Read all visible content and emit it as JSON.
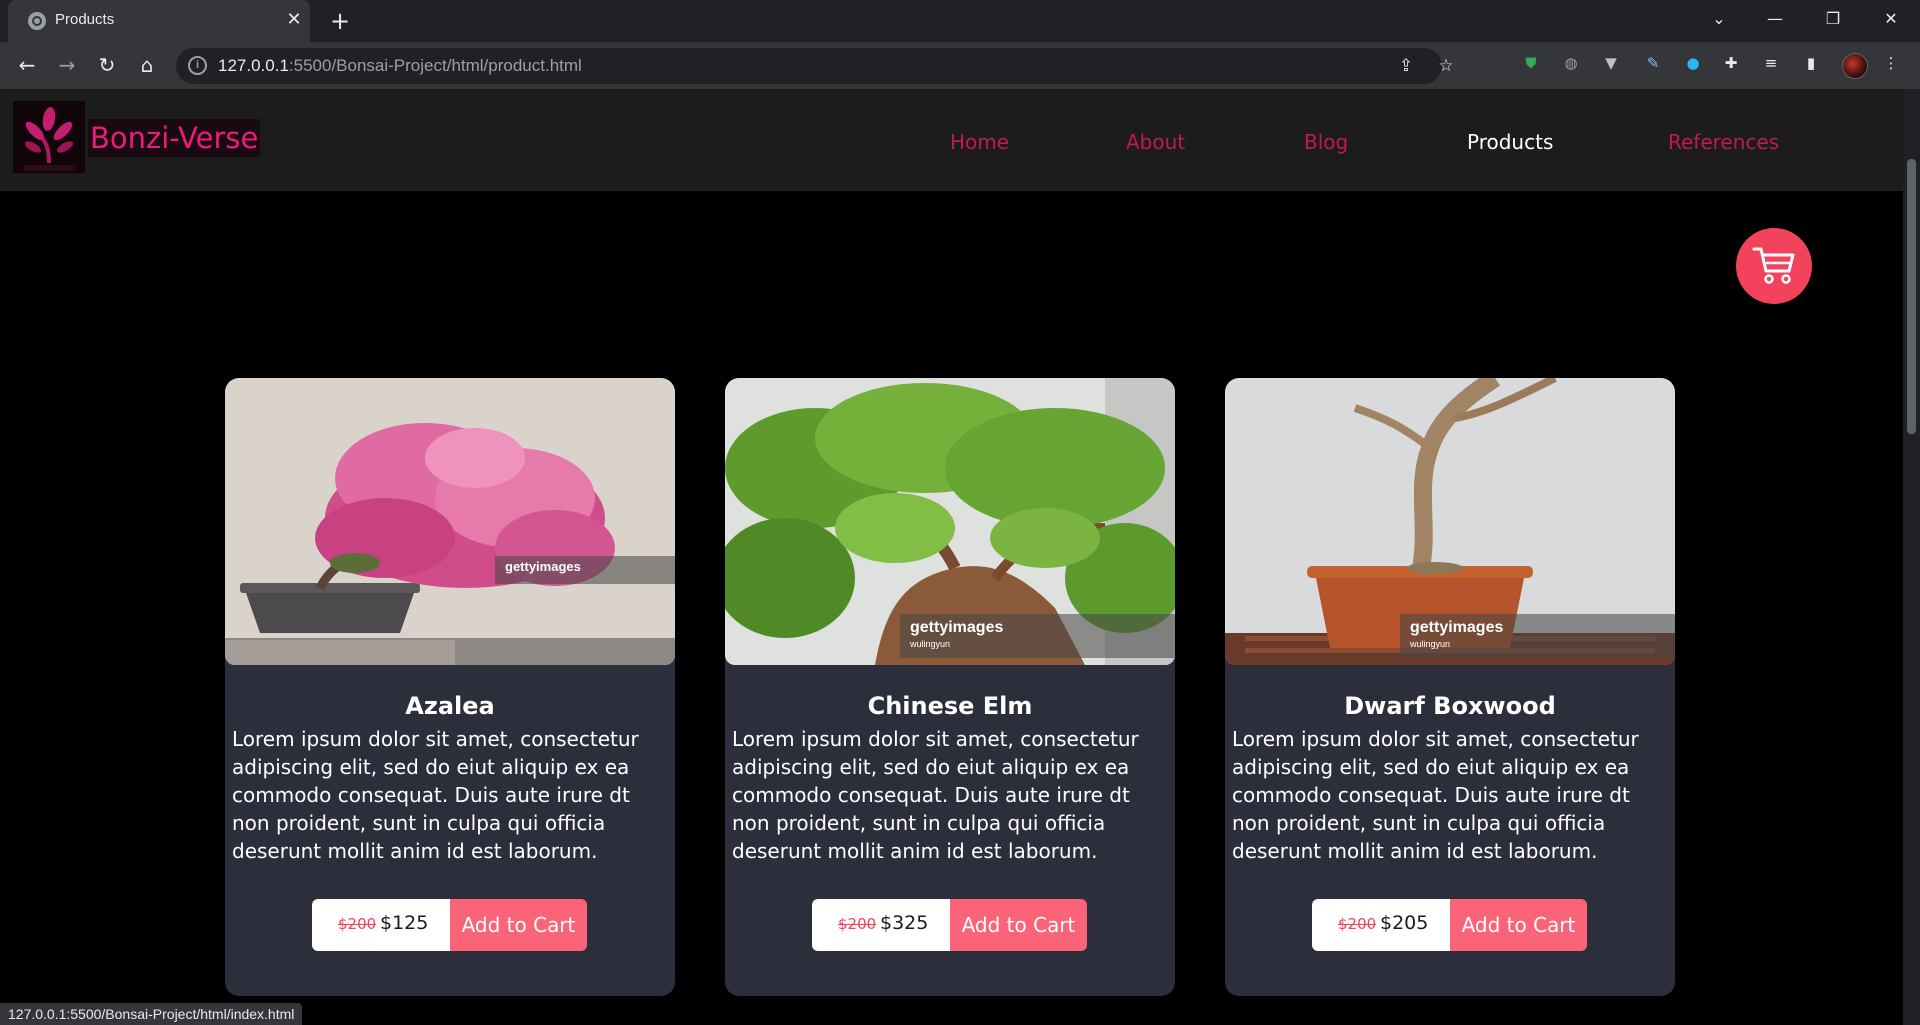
{
  "browser": {
    "tab_title": "Products",
    "url_host": "127.0.0.1",
    "url_path": ":5500/Bonsai-Project/html/product.html",
    "status_url": "127.0.0.1:5500/Bonsai-Project/html/index.html"
  },
  "site": {
    "brand": "Bonzi-Verse",
    "nav": [
      {
        "label": "Home",
        "active": false
      },
      {
        "label": "About",
        "active": false
      },
      {
        "label": "Blog",
        "active": false
      },
      {
        "label": "Products",
        "active": true
      },
      {
        "label": "References",
        "active": false
      }
    ],
    "cart_icon": "shopping-cart-icon"
  },
  "products": [
    {
      "name": "Azalea",
      "description": "Lorem ipsum dolor sit amet, consectetur adipiscing elit, sed do eiut aliquip ex ea commodo consequat. Duis aute irure dt non proident, sunt in culpa qui officia deserunt mollit anim id est laborum.",
      "old_price": "$200",
      "price": "$125",
      "button": "Add to Cart",
      "watermark": "gettyimages",
      "watermark_credit": ""
    },
    {
      "name": "Chinese Elm",
      "description": "Lorem ipsum dolor sit amet, consectetur adipiscing elit, sed do eiut aliquip ex ea commodo consequat. Duis aute irure dt non proident, sunt in culpa qui officia deserunt mollit anim id est laborum.",
      "old_price": "$200",
      "price": "$325",
      "button": "Add to Cart",
      "watermark": "gettyimages",
      "watermark_credit": "wulingyun"
    },
    {
      "name": "Dwarf Boxwood",
      "description": "Lorem ipsum dolor sit amet, consectetur adipiscing elit, sed do eiut aliquip ex ea commodo consequat. Duis aute irure dt non proident, sunt in culpa qui officia deserunt mollit anim id est laborum.",
      "old_price": "$200",
      "price": "$205",
      "button": "Add to Cart",
      "watermark": "gettyimages",
      "watermark_credit": "wulingyun"
    }
  ],
  "colors": {
    "accent_pink": "#f2425c",
    "button_pink": "#fa6479",
    "nav_link": "#c2185b",
    "card_bg": "#2c2f3b"
  }
}
